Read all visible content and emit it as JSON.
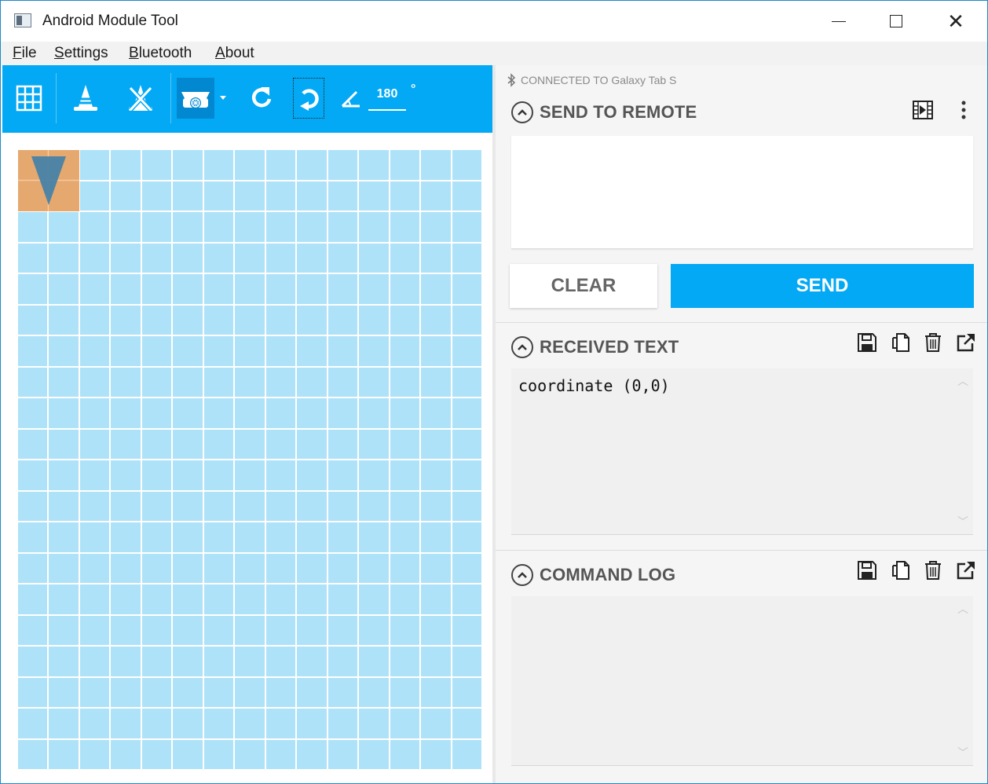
{
  "window": {
    "title": "Android Module Tool"
  },
  "menu": {
    "items": [
      {
        "first": "F",
        "rest": "ile"
      },
      {
        "first": "S",
        "rest": "ettings"
      },
      {
        "first": "B",
        "rest": "luetooth"
      },
      {
        "first": "A",
        "rest": "bout"
      }
    ]
  },
  "toolbar": {
    "angle_value": "180",
    "angle_unit": "°"
  },
  "connection": {
    "status": "CONNECTED TO Galaxy Tab S"
  },
  "send_section": {
    "title": "SEND TO REMOTE",
    "input_value": "",
    "clear_label": "CLEAR",
    "send_label": "SEND"
  },
  "received_section": {
    "title": "RECEIVED TEXT",
    "text": "coordinate (0,0)"
  },
  "command_log": {
    "title": "COMMAND LOG",
    "text": ""
  },
  "grid": {
    "columns": 15,
    "rows": 20,
    "robot_cell": {
      "col": 0,
      "row": 0
    },
    "robot_heading_degrees": 180
  },
  "colors": {
    "accent": "#03a9f4",
    "cell": "#aee2f8",
    "robot": "#e8a567",
    "robot_arrow": "#4a7fa0"
  }
}
